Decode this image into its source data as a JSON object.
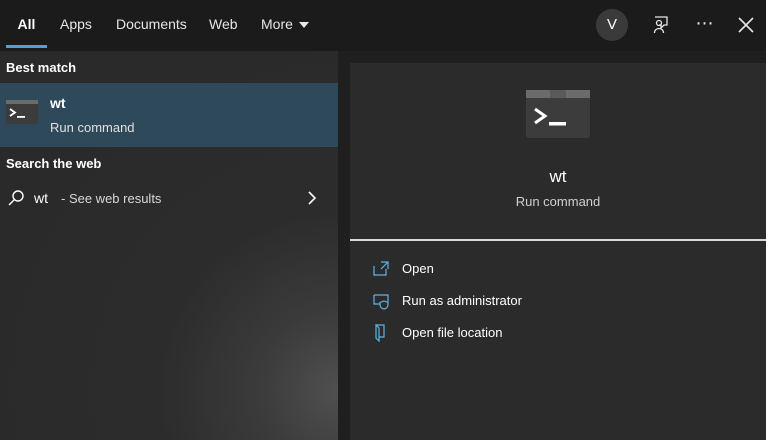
{
  "tabs": [
    {
      "label": "All"
    },
    {
      "label": "Apps"
    },
    {
      "label": "Documents"
    },
    {
      "label": "Web"
    },
    {
      "label": "More"
    }
  ],
  "user": {
    "initial": "V"
  },
  "more_icon": "⋯",
  "left": {
    "best_match_heading": "Best match",
    "best_match": {
      "title": "wt",
      "subtitle": "Run command",
      "icon": "terminal-icon"
    },
    "web_heading": "Search the web",
    "web_result": {
      "query": "wt",
      "suffix": "- See web results"
    }
  },
  "detail": {
    "title": "wt",
    "subtitle": "Run command",
    "actions": [
      {
        "label": "Open",
        "icon": "open-icon"
      },
      {
        "label": "Run as administrator",
        "icon": "shield-icon"
      },
      {
        "label": "Open file location",
        "icon": "file-location-icon"
      }
    ]
  },
  "colors": {
    "accent": "#4aa3df",
    "selection": "#2e4a5a",
    "action_icon": "#5fb3e6"
  }
}
